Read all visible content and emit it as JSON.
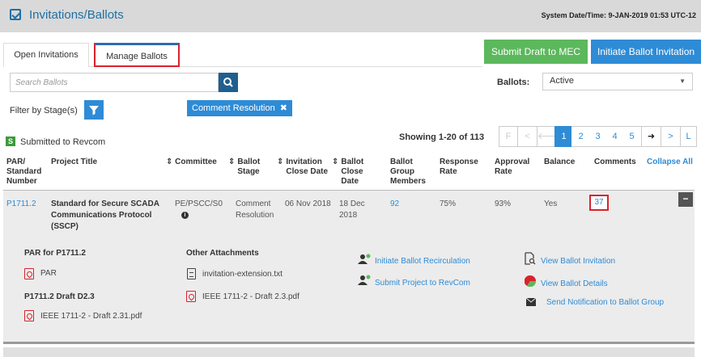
{
  "header": {
    "title": "Invitations/Ballots",
    "system_time": "System Date/Time: 9-JAN-2019  01:53 UTC-12"
  },
  "tabs": [
    {
      "label": "Open Invitations"
    },
    {
      "label": "Manage Ballots"
    }
  ],
  "actions": {
    "submit_draft": "Submit Draft to MEC",
    "initiate_invitation": "Initiate Ballot Invitation"
  },
  "search": {
    "placeholder": "Search Ballots"
  },
  "ballots_filter": {
    "label": "Ballots:",
    "value": "Active"
  },
  "stage_filter": {
    "label": "Filter by Stage(s)",
    "chip": "Comment Resolution"
  },
  "status": {
    "badge": "S",
    "text": "Submitted to Revcom"
  },
  "pagination": {
    "showing": "Showing 1-20 of 113",
    "pages": [
      "1",
      "2",
      "3",
      "4",
      "5"
    ],
    "first_label": "F",
    "last_label": "L"
  },
  "table": {
    "headers": {
      "par": "PAR/\nStandard\nNumber",
      "project_title": "Project Title",
      "committee": "Committee",
      "ballot_stage": "Ballot\nStage",
      "invitation_close": "Invitation\nClose Date",
      "ballot_close": "Ballot\nClose\nDate",
      "group_members": "Ballot\nGroup\nMembers",
      "response_rate": "Response\nRate",
      "approval_rate": "Approval\nRate",
      "balance": "Balance",
      "comments": "Comments",
      "collapse_all": "Collapse All"
    },
    "row": {
      "par": "P1711.2",
      "project_title": "Standard for Secure SCADA Communications Protocol (SSCP)",
      "committee": "PE/PSCC/S0",
      "ballot_stage": "Comment Resolution",
      "invitation_close": "06 Nov 2018",
      "ballot_close": "18 Dec 2018",
      "group_members": "92",
      "response_rate": "75%",
      "approval_rate": "93%",
      "balance": "Yes",
      "comments": "37"
    }
  },
  "detail": {
    "par_heading": "PAR for P1711.2",
    "par_file": "PAR",
    "draft_heading": "P1711.2 Draft D2.3",
    "draft_file": "IEEE 1711-2 - Draft 2.31.pdf",
    "other_heading": "Other Attachments",
    "other_file1": "invitation-extension.txt",
    "other_file2": "IEEE 1711-2 - Draft 2.3.pdf",
    "action_recirc": "Initiate Ballot Recirculation",
    "action_revcom": "Submit Project to RevCom",
    "action_view_invitation": "View Ballot Invitation",
    "action_view_details": "View Ballot Details",
    "action_notify": "Send Notification to Ballot Group"
  },
  "colors": {
    "link": "#2e8bd6",
    "green": "#5cb85c",
    "highlight": "#d9232d",
    "header_bg": "#d9d9d9"
  }
}
